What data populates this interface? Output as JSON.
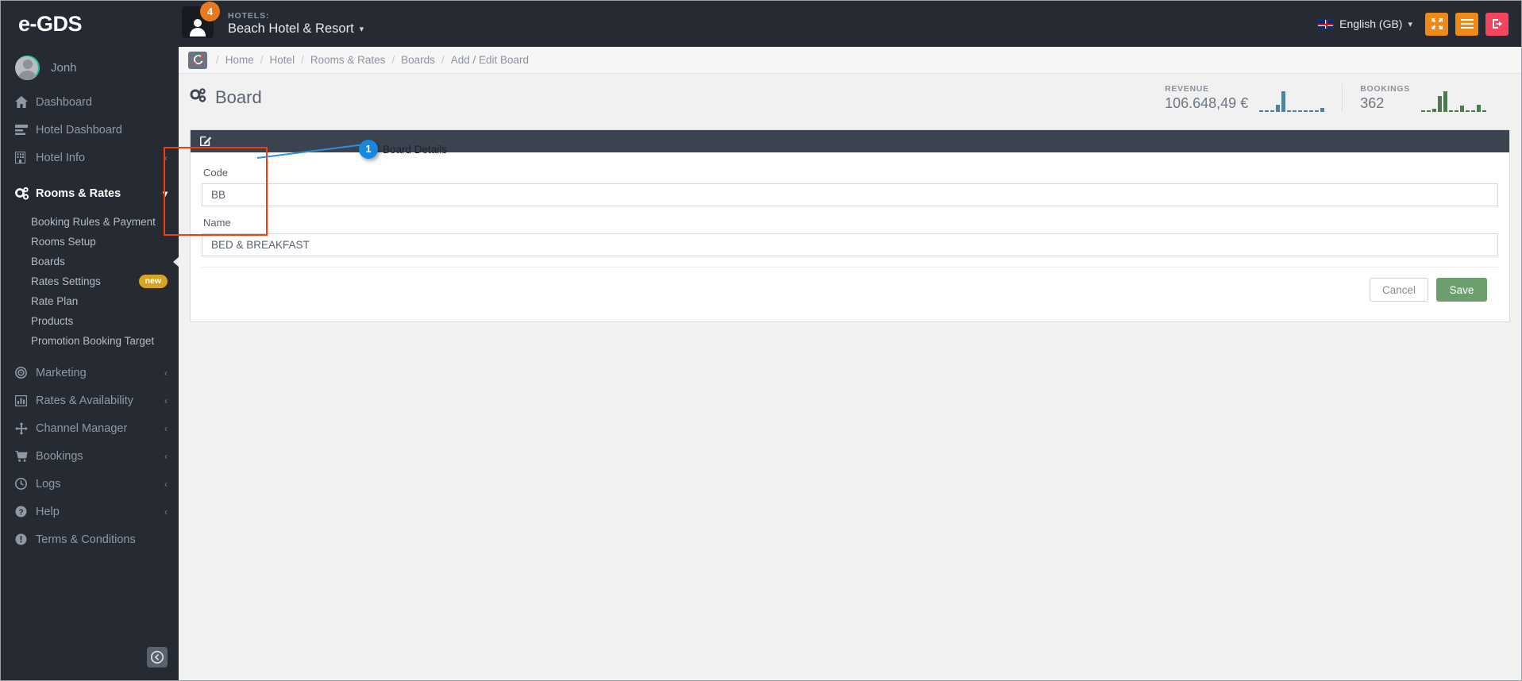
{
  "header": {
    "brand": "e-GDS",
    "notification_count": "4",
    "hotels_label": "HOTELS:",
    "hotel_name": "Beach Hotel & Resort",
    "caret": "⌄",
    "language": "English (GB)",
    "icons": {
      "user_avatar": "user-avatar-icon",
      "expand": "expand-fullscreen-icon",
      "menu": "hamburger-menu-icon",
      "logout": "logout-icon"
    },
    "colors": {
      "bar": "#252a33",
      "orange": "#ef8a17",
      "red": "#f5455f",
      "badge": "#e8791c"
    }
  },
  "sidebar": {
    "user": "Jonh",
    "items": [
      {
        "label": "Dashboard",
        "icon": "home-icon",
        "glyph": "⌂",
        "chevron": ""
      },
      {
        "label": "Hotel Dashboard",
        "icon": "dashboard-bars-icon",
        "glyph": "☰",
        "chevron": ""
      },
      {
        "label": "Hotel Info",
        "icon": "building-icon",
        "glyph": "▤",
        "chevron": "‹"
      },
      {
        "label": "Rooms & Rates",
        "icon": "gears-icon",
        "glyph": "⚙",
        "chevron": "∨"
      }
    ],
    "sub_items": [
      {
        "label": "Booking Rules & Payment",
        "badge": "",
        "active": false
      },
      {
        "label": "Rooms Setup",
        "badge": "",
        "active": false
      },
      {
        "label": "Boards",
        "badge": "",
        "active": true
      },
      {
        "label": "Rates Settings",
        "badge": "new",
        "active": false
      },
      {
        "label": "Rate Plan",
        "badge": "",
        "active": false
      },
      {
        "label": "Products",
        "badge": "",
        "active": false
      },
      {
        "label": "Promotion Booking Target",
        "badge": "",
        "active": false
      }
    ],
    "items_lower": [
      {
        "label": "Marketing",
        "icon": "target-icon",
        "glyph": "◎",
        "chevron": "‹"
      },
      {
        "label": "Rates & Availability",
        "icon": "bar-chart-icon",
        "glyph": "ὌA",
        "chevron": "‹"
      },
      {
        "label": "Channel Manager",
        "icon": "move-arrows-icon",
        "glyph": "✥",
        "chevron": "‹"
      },
      {
        "label": "Bookings",
        "icon": "cart-icon",
        "glyph": "Ὥ2",
        "chevron": "‹"
      },
      {
        "label": "Logs",
        "icon": "clock-icon",
        "glyph": "◴",
        "chevron": "‹"
      },
      {
        "label": "Help",
        "icon": "question-circle-icon",
        "glyph": "❓",
        "chevron": "‹"
      },
      {
        "label": "Terms & Conditions",
        "icon": "exclamation-circle-icon",
        "glyph": "❗",
        "chevron": ""
      }
    ],
    "collapse_icon": "collapse-sidebar-icon",
    "collapse_glyph": "←"
  },
  "breadcrumb": {
    "refresh_icon": "refresh-icon",
    "refresh_glyph": "↻",
    "items": [
      "Home",
      "Hotel",
      "Rooms & Rates",
      "Boards",
      "Add / Edit Board"
    ],
    "separator": "/"
  },
  "page": {
    "title": "Board",
    "title_icon": "gears-icon"
  },
  "stats": [
    {
      "label": "REVENUE",
      "value": "106.648,49 €",
      "color": "#4e83a0",
      "spark": [
        1,
        1,
        1,
        7,
        20,
        1,
        1,
        1,
        1,
        1,
        1,
        4
      ]
    },
    {
      "label": "BOOKINGS",
      "value": "362",
      "color": "#4a7a4d",
      "spark": [
        1,
        1,
        3,
        15,
        20,
        1,
        1,
        6,
        1,
        1,
        7,
        1
      ]
    }
  ],
  "panel": {
    "head_icon": "edit-pencil-square-icon",
    "head_glyph": "✎",
    "fields": [
      {
        "label": "Code",
        "value": "BB",
        "name": "code-field"
      },
      {
        "label": "Name",
        "value": "BED & BREAKFAST",
        "name": "name-field"
      }
    ],
    "cancel_label": "Cancel",
    "save_label": "Save"
  },
  "annotation": {
    "number": "1",
    "text": "Board Details",
    "box_color": "#f43d0d",
    "pin_color": "#1787e0"
  }
}
